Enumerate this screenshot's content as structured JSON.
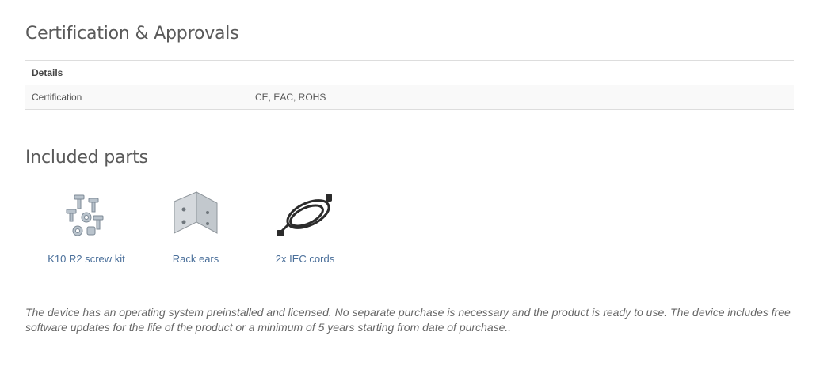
{
  "certification": {
    "title": "Certification & Approvals",
    "table": {
      "header": "Details",
      "rows": [
        {
          "label": "Certification",
          "value": "CE, EAC, ROHS"
        }
      ]
    }
  },
  "included_parts": {
    "title": "Included parts",
    "items": [
      {
        "label": "K10 R2 screw kit",
        "icon": "screw-kit-icon"
      },
      {
        "label": "Rack ears",
        "icon": "rack-ear-icon"
      },
      {
        "label": "2x IEC cords",
        "icon": "power-cord-icon"
      }
    ]
  },
  "note": "The device has an operating system preinstalled and licensed. No separate purchase is necessary and the product is ready to use. The device includes free software updates for the life of the product or a minimum of 5 years starting from date of purchase.."
}
